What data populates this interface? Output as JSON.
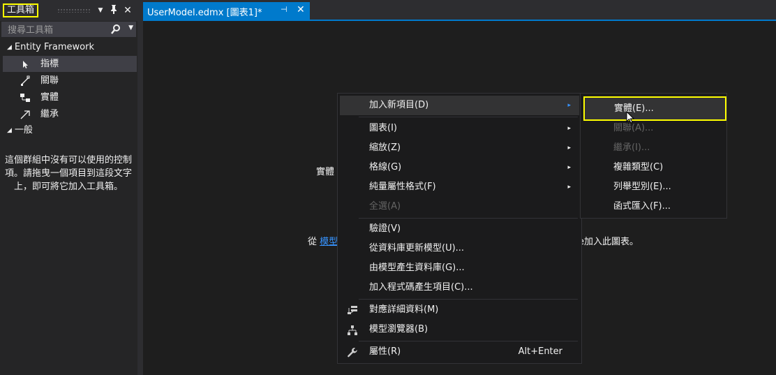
{
  "toolbox": {
    "title": "工具箱",
    "pin_glyph": "🖈",
    "close_glyph": "✕",
    "dropdown_glyph": "▼",
    "search_placeholder": "搜尋工具箱",
    "groups": [
      {
        "label": "Entity Framework",
        "items": [
          "指標",
          "關聯",
          "實體",
          "繼承"
        ]
      },
      {
        "label": "一般"
      }
    ],
    "empty_message": "這個群組中沒有可以使用的控制項。請拖曳一個項目到這段文字上，即可將它加入工具箱。"
  },
  "document_tab": {
    "label": "UserModel.edmx [圖表1]*",
    "pin_glyph": "⊣",
    "close_glyph": "✕"
  },
  "canvas": {
    "hint_line1_prefix": "實體",
    "hint_line2_prefix": "從",
    "hint_line2_link": "模型",
    "hint_line2_suffix": "e加入此圖表。"
  },
  "context_menu": {
    "items": [
      {
        "label": "加入新項目(D)",
        "submenu": true,
        "highlighted": true
      },
      {
        "label": "圖表(I)",
        "submenu": true
      },
      {
        "label": "縮放(Z)",
        "submenu": true
      },
      {
        "label": "格線(G)",
        "submenu": true
      },
      {
        "label": "純量屬性格式(F)",
        "submenu": true
      },
      {
        "label": "全選(A)",
        "disabled": true
      },
      {
        "label": "驗證(V)"
      },
      {
        "label": "從資料庫更新模型(U)..."
      },
      {
        "label": "由模型產生資料庫(G)..."
      },
      {
        "label": "加入程式碼產生項目(C)..."
      },
      {
        "label": "對應詳細資料(M)",
        "icon": "mapping-details-icon"
      },
      {
        "label": "模型瀏覽器(B)",
        "icon": "model-browser-icon"
      },
      {
        "label": "屬性(R)",
        "icon": "wrench-icon",
        "shortcut": "Alt+Enter"
      }
    ],
    "arrow_glyph": "▸"
  },
  "submenu": {
    "items": [
      {
        "label": "實體(E)...",
        "highlighted": true
      },
      {
        "label": "關聯(A)...",
        "disabled": true
      },
      {
        "label": "繼承(I)...",
        "disabled": true
      },
      {
        "label": "複雜類型(C)"
      },
      {
        "label": "列舉型別(E)..."
      },
      {
        "label": "函式匯入(F)..."
      }
    ]
  },
  "colors": {
    "accent": "#007acc",
    "highlight_box": "#ffff00",
    "link": "#3794ff",
    "disabled_text": "#656565"
  }
}
